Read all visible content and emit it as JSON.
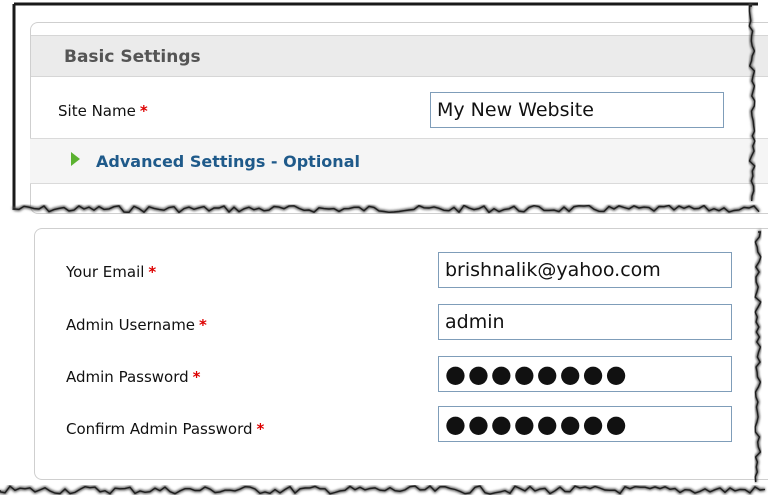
{
  "basic_settings": {
    "title": "Basic Settings",
    "site_name": {
      "label": "Site Name",
      "required_mark": "*",
      "value": "My New Website"
    },
    "advanced_toggle": {
      "label": "Advanced Settings - Optional",
      "icon": "triangle-right-icon",
      "state": "collapsed"
    }
  },
  "admin_account": {
    "email": {
      "label": "Your Email",
      "required_mark": "*",
      "value": "brishnalik@yahoo.com"
    },
    "username": {
      "label": "Admin Username",
      "required_mark": "*",
      "value": "admin"
    },
    "password": {
      "label": "Admin Password",
      "required_mark": "*",
      "value": "●●●●●●●●"
    },
    "confirm_password": {
      "label": "Confirm Admin Password",
      "required_mark": "*",
      "value": "●●●●●●●●"
    }
  },
  "colors": {
    "required": "#dd0000",
    "link": "#1f5a8a",
    "arrow": "#5bb230",
    "input_border": "#7f9db9",
    "header_bg": "#ebebeb"
  }
}
